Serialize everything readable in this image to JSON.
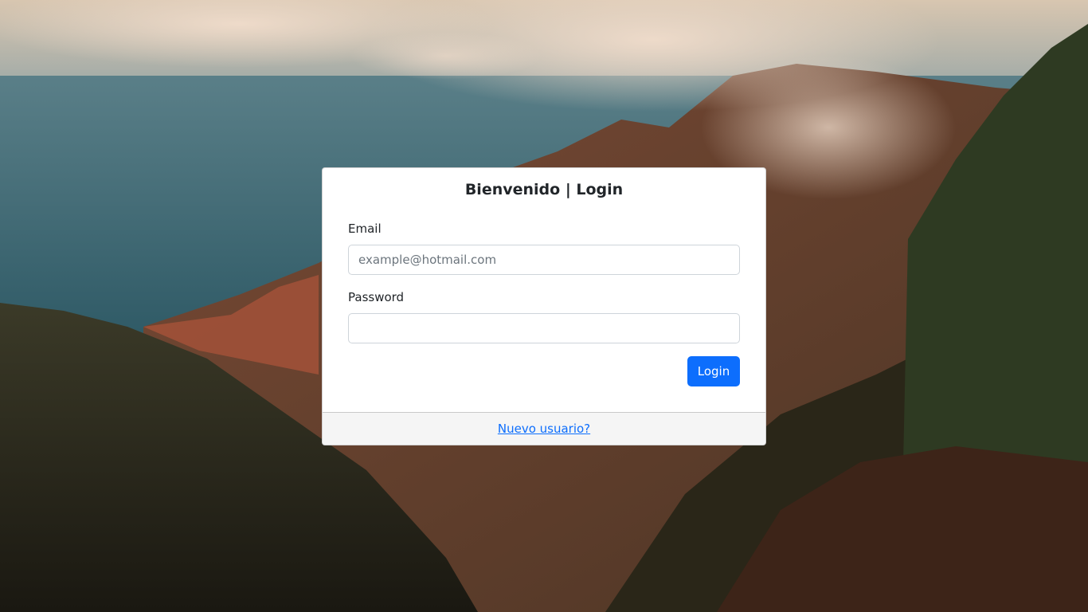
{
  "login_card": {
    "title": "Bienvenido | Login",
    "email_label": "Email",
    "email_placeholder": "example@hotmail.com",
    "email_value": "",
    "password_label": "Password",
    "password_value": "",
    "login_button_label": "Login",
    "register_link_label": "Nuevo usuario?"
  },
  "colors": {
    "primary": "#0d6efd",
    "card_background": "#ffffff",
    "footer_background": "#f5f5f5",
    "text": "#212529"
  }
}
